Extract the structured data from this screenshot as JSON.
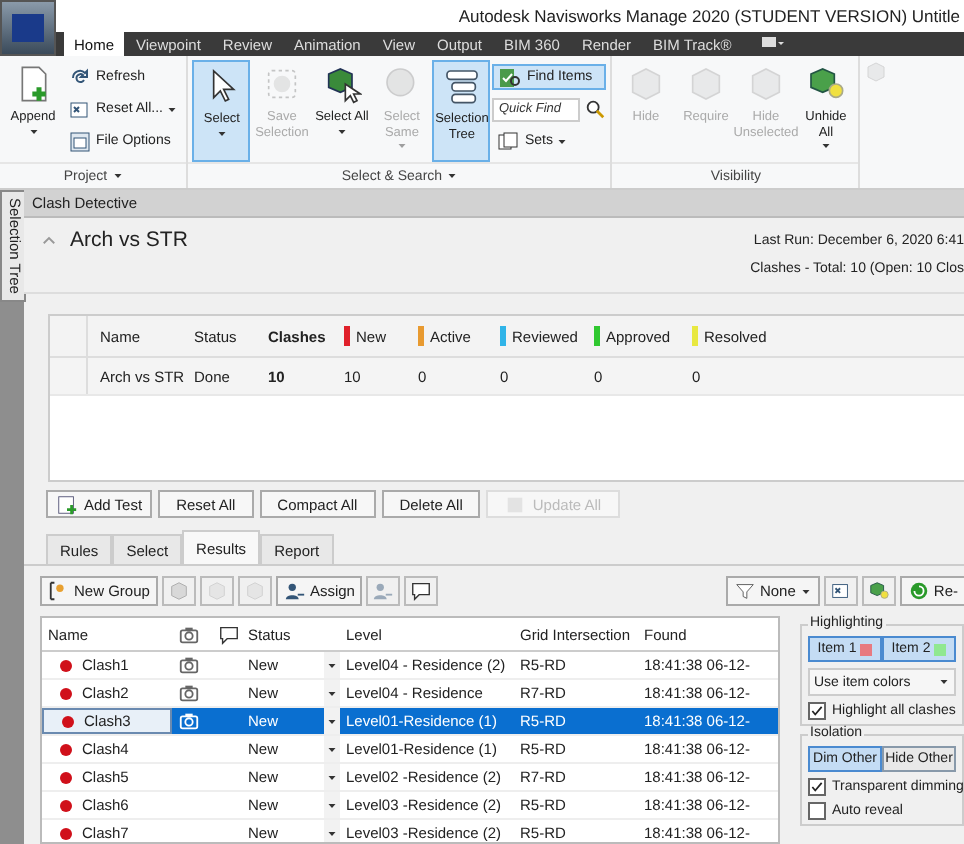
{
  "window": {
    "title": "Autodesk Navisworks Manage 2020 (STUDENT VERSION)   Untitle"
  },
  "ribbon": {
    "tabs": [
      {
        "label": "Home",
        "selected": true
      },
      {
        "label": "Viewpoint",
        "selected": false
      },
      {
        "label": "Review",
        "selected": false
      },
      {
        "label": "Animation",
        "selected": false
      },
      {
        "label": "View",
        "selected": false
      },
      {
        "label": "Output",
        "selected": false
      },
      {
        "label": "BIM 360",
        "selected": false
      },
      {
        "label": "Render",
        "selected": false
      },
      {
        "label": "BIM Track®",
        "selected": false
      }
    ],
    "panels": [
      {
        "title": "Project",
        "menu": true,
        "groups": [
          {
            "kind": "large",
            "label": "Append",
            "dropdown": true,
            "selected": false,
            "disabled": false
          },
          {
            "kind": "stack",
            "items": [
              {
                "kind": "button",
                "label": "Refresh",
                "dropdown": false,
                "selected": false,
                "disabled": false
              },
              {
                "kind": "button",
                "label": "Reset All...",
                "dropdown": true,
                "selected": false,
                "disabled": false
              },
              {
                "kind": "button",
                "label": "File Options",
                "dropdown": false,
                "selected": false,
                "disabled": false
              }
            ]
          }
        ]
      },
      {
        "title": "Select & Search",
        "menu": true,
        "groups": [
          {
            "kind": "large",
            "label": "Select",
            "dropdown": true,
            "selected": true,
            "disabled": false
          },
          {
            "kind": "large",
            "label": "Save Selection",
            "dropdown": false,
            "selected": false,
            "disabled": true
          },
          {
            "kind": "large",
            "label": "Select All",
            "dropdown": true,
            "selected": false,
            "disabled": false
          },
          {
            "kind": "large",
            "label": "Select Same",
            "dropdown": true,
            "selected": false,
            "disabled": true
          },
          {
            "kind": "large",
            "label": "Selection Tree",
            "dropdown": false,
            "selected": true,
            "disabled": false
          },
          {
            "kind": "stack",
            "items": [
              {
                "kind": "button",
                "label": "Find Items",
                "dropdown": false,
                "selected": true,
                "disabled": false
              },
              {
                "kind": "field",
                "placeholder": "Quick Find"
              },
              {
                "kind": "button",
                "label": "Sets",
                "dropdown": true,
                "selected": false,
                "disabled": false
              }
            ]
          }
        ]
      },
      {
        "title": "Visibility",
        "menu": false,
        "groups": [
          {
            "kind": "large",
            "label": "Hide",
            "dropdown": false,
            "selected": false,
            "disabled": true
          },
          {
            "kind": "large",
            "label": "Require",
            "dropdown": false,
            "selected": false,
            "disabled": true
          },
          {
            "kind": "large",
            "label": "Hide Unselected",
            "dropdown": false,
            "selected": false,
            "disabled": true
          },
          {
            "kind": "large",
            "label": "Unhide All",
            "dropdown": true,
            "selected": false,
            "disabled": false
          }
        ]
      }
    ]
  },
  "side_tab": "Selection Tree",
  "panel_title": "Clash Detective",
  "test": {
    "name": "Arch vs STR",
    "expanded": true,
    "last_run": "Last Run:  December 6, 2020 6:41",
    "summary": "Clashes -  Total:  10  (Open:  10  Clos"
  },
  "tests_table": {
    "columns": [
      {
        "label": "Name",
        "bold": false
      },
      {
        "label": "Status",
        "bold": false
      },
      {
        "label": "Clashes",
        "bold": true
      },
      {
        "label": "New",
        "bold": false,
        "color": "#e0202a"
      },
      {
        "label": "Active",
        "bold": false,
        "color": "#e89a30"
      },
      {
        "label": "Reviewed",
        "bold": false,
        "color": "#30b4e8"
      },
      {
        "label": "Approved",
        "bold": false,
        "color": "#30c830"
      },
      {
        "label": "Resolved",
        "bold": false,
        "color": "#e8e840"
      }
    ],
    "rows": [
      {
        "cells": [
          "Arch vs STR",
          "Done",
          "10",
          "10",
          "0",
          "0",
          "0",
          "0"
        ]
      }
    ]
  },
  "test_buttons": [
    {
      "label": "Add Test",
      "disabled": false
    },
    {
      "label": "Reset All",
      "disabled": false
    },
    {
      "label": "Compact All",
      "disabled": false
    },
    {
      "label": "Delete All",
      "disabled": false
    },
    {
      "label": "Update All",
      "disabled": true
    }
  ],
  "tabs": [
    {
      "label": "Rules",
      "selected": false
    },
    {
      "label": "Select",
      "selected": false
    },
    {
      "label": "Results",
      "selected": true
    },
    {
      "label": "Report",
      "selected": false
    }
  ],
  "toolbar": {
    "new_group": "New Group",
    "assign": "Assign",
    "filter": "None",
    "rerun": "Re-"
  },
  "results": {
    "columns": [
      "Name",
      "Status",
      "Level",
      "Grid Intersection",
      "Found"
    ],
    "rows": [
      {
        "name": "Clash1",
        "color": "#d0101a",
        "viewpoint": true,
        "status": "New",
        "level": "Level04 - Residence (2)",
        "grid": "R5-RD",
        "found": "18:41:38 06-12-",
        "selected": false
      },
      {
        "name": "Clash2",
        "color": "#d0101a",
        "viewpoint": true,
        "status": "New",
        "level": "Level04 - Residence",
        "grid": "R7-RD",
        "found": "18:41:38 06-12-",
        "selected": false
      },
      {
        "name": "Clash3",
        "color": "#d0101a",
        "viewpoint": true,
        "status": "New",
        "level": "Level01-Residence (1)",
        "grid": "R5-RD",
        "found": "18:41:38 06-12-",
        "selected": true
      },
      {
        "name": "Clash4",
        "color": "#d0101a",
        "viewpoint": false,
        "status": "New",
        "level": "Level01-Residence (1)",
        "grid": "R5-RD",
        "found": "18:41:38 06-12-",
        "selected": false
      },
      {
        "name": "Clash5",
        "color": "#d0101a",
        "viewpoint": false,
        "status": "New",
        "level": "Level02 -Residence (2)",
        "grid": "R7-RD",
        "found": "18:41:38 06-12-",
        "selected": false
      },
      {
        "name": "Clash6",
        "color": "#d0101a",
        "viewpoint": false,
        "status": "New",
        "level": "Level03 -Residence (2)",
        "grid": "R5-RD",
        "found": "18:41:38 06-12-",
        "selected": false
      },
      {
        "name": "Clash7",
        "color": "#d0101a",
        "viewpoint": false,
        "status": "New",
        "level": "Level03 -Residence (2)",
        "grid": "R5-RD",
        "found": "18:41:38 06-12-",
        "selected": false
      }
    ]
  },
  "highlighting": {
    "title": "Highlighting",
    "items": [
      {
        "label": "Item 1",
        "color": "#e87a80",
        "selected": true
      },
      {
        "label": "Item 2",
        "color": "#90e890",
        "selected": true
      }
    ],
    "mode": "Use item colors",
    "highlight_all": {
      "label": "Highlight all clashes",
      "checked": true
    }
  },
  "isolation": {
    "title": "Isolation",
    "options": [
      {
        "label": "Dim Other",
        "selected": true
      },
      {
        "label": "Hide Other",
        "selected": false
      }
    ],
    "checks": [
      {
        "label": "Transparent dimming",
        "checked": true
      },
      {
        "label": "Auto reveal",
        "checked": false
      }
    ]
  }
}
